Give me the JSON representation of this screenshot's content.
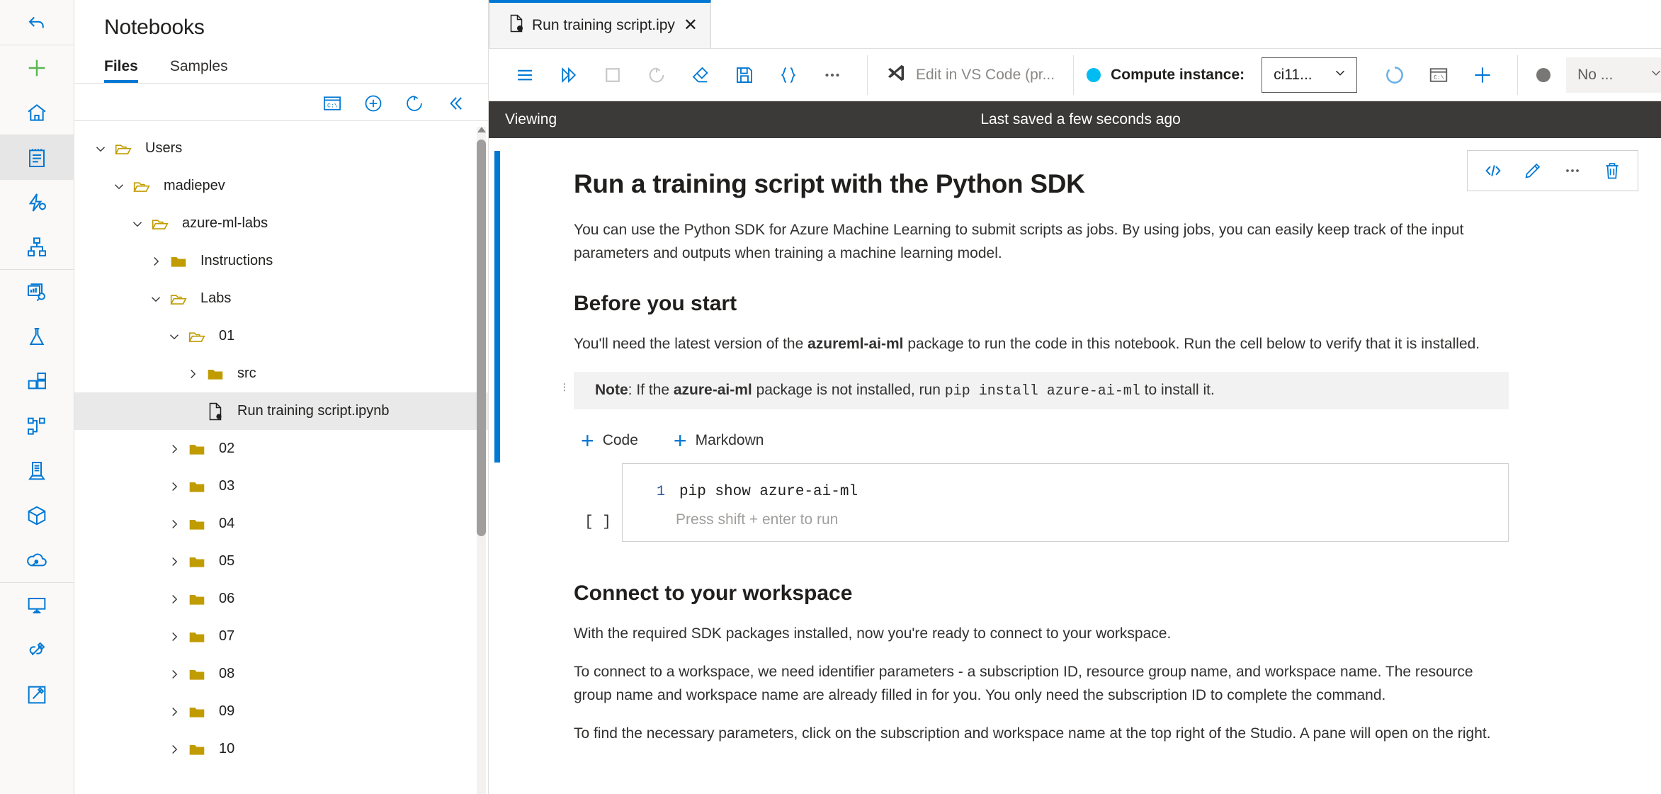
{
  "rail": {
    "items": [
      {
        "name": "back-arrow-icon",
        "label": "Back"
      },
      {
        "name": "create-new-icon",
        "label": "Create new"
      },
      {
        "name": "home-icon",
        "label": "Home"
      },
      {
        "name": "notebooks-icon",
        "label": "Notebooks"
      },
      {
        "name": "automated-ml-icon",
        "label": "Automated ML"
      },
      {
        "name": "designer-icon",
        "label": "Designer"
      },
      {
        "name": "data-icon",
        "label": "Data"
      },
      {
        "name": "jobs-icon",
        "label": "Jobs"
      },
      {
        "name": "components-icon",
        "label": "Components"
      },
      {
        "name": "pipelines-icon",
        "label": "Pipelines"
      },
      {
        "name": "environments-icon",
        "label": "Environments"
      },
      {
        "name": "models-icon",
        "label": "Models"
      },
      {
        "name": "endpoints-icon",
        "label": "Endpoints"
      },
      {
        "name": "compute-icon",
        "label": "Compute"
      },
      {
        "name": "linked-services-icon",
        "label": "Linked Services"
      },
      {
        "name": "data-labeling-icon",
        "label": "Data labeling"
      }
    ]
  },
  "files_panel": {
    "title": "Notebooks",
    "tabs": [
      {
        "label": "Files",
        "selected": true
      },
      {
        "label": "Samples",
        "selected": false
      }
    ],
    "toolbar": [
      {
        "name": "terminal-icon",
        "label": "Open terminal"
      },
      {
        "name": "add-files-icon",
        "label": "Create new file"
      },
      {
        "name": "refresh-icon",
        "label": "Refresh"
      },
      {
        "name": "collapse-icon",
        "label": "Collapse"
      }
    ],
    "tree": [
      {
        "label": "Users",
        "depth": 0,
        "type": "folder-open",
        "expanded": true,
        "selected": false
      },
      {
        "label": "madiepev",
        "depth": 1,
        "type": "folder-open",
        "expanded": true,
        "selected": false
      },
      {
        "label": "azure-ml-labs",
        "depth": 2,
        "type": "folder-open",
        "expanded": true,
        "selected": false
      },
      {
        "label": "Instructions",
        "depth": 3,
        "type": "folder-closed",
        "expanded": false,
        "selected": false
      },
      {
        "label": "Labs",
        "depth": 3,
        "type": "folder-open",
        "expanded": true,
        "selected": false
      },
      {
        "label": "01",
        "depth": 4,
        "type": "folder-open",
        "expanded": true,
        "selected": false
      },
      {
        "label": "src",
        "depth": 5,
        "type": "folder-closed",
        "expanded": false,
        "selected": false
      },
      {
        "label": "Run training script.ipynb",
        "depth": 5,
        "type": "notebook",
        "expanded": null,
        "selected": true
      },
      {
        "label": "02",
        "depth": 4,
        "type": "folder-closed",
        "expanded": false,
        "selected": false
      },
      {
        "label": "03",
        "depth": 4,
        "type": "folder-closed",
        "expanded": false,
        "selected": false
      },
      {
        "label": "04",
        "depth": 4,
        "type": "folder-closed",
        "expanded": false,
        "selected": false
      },
      {
        "label": "05",
        "depth": 4,
        "type": "folder-closed",
        "expanded": false,
        "selected": false
      },
      {
        "label": "06",
        "depth": 4,
        "type": "folder-closed",
        "expanded": false,
        "selected": false
      },
      {
        "label": "07",
        "depth": 4,
        "type": "folder-closed",
        "expanded": false,
        "selected": false
      },
      {
        "label": "08",
        "depth": 4,
        "type": "folder-closed",
        "expanded": false,
        "selected": false
      },
      {
        "label": "09",
        "depth": 4,
        "type": "folder-closed",
        "expanded": false,
        "selected": false
      },
      {
        "label": "10",
        "depth": 4,
        "type": "folder-closed",
        "expanded": false,
        "selected": false
      }
    ]
  },
  "notebook_tab": {
    "label": "Run training script.ipy",
    "close_label": "✕"
  },
  "toolbar": {
    "buttons": [
      {
        "name": "menu-icon",
        "label": "Menu"
      },
      {
        "name": "run-all-icon",
        "label": "Run all"
      },
      {
        "name": "stop-icon",
        "label": "Stop"
      },
      {
        "name": "restart-icon",
        "label": "Restart kernel"
      },
      {
        "name": "clear-outputs-icon",
        "label": "Clear outputs"
      },
      {
        "name": "save-icon",
        "label": "Save"
      },
      {
        "name": "json-icon",
        "label": "Edit JSON"
      },
      {
        "name": "more-icon",
        "label": "More"
      }
    ],
    "vscode_label": "Edit in VS Code (pr...",
    "compute_label": "Compute instance:",
    "compute_value": "ci11...",
    "compute_status_color": "#00bcf2",
    "kernel_value": "No ...",
    "kernel_status_color": "#797775",
    "compute_actions": [
      {
        "name": "compute-spinner-icon",
        "label": "Loading"
      },
      {
        "name": "terminal-icon",
        "label": "Terminal"
      },
      {
        "name": "add-compute-icon",
        "label": "New compute"
      }
    ]
  },
  "status_bar": {
    "mode": "Viewing",
    "saved": "Last saved a few seconds ago"
  },
  "cell_tools": [
    {
      "name": "convert-to-code-icon",
      "label": "</>"
    },
    {
      "name": "edit-pencil-icon",
      "label": "Edit"
    },
    {
      "name": "more-options-icon",
      "label": "•••"
    },
    {
      "name": "delete-trash-icon",
      "label": "Delete"
    }
  ],
  "content": {
    "h1": "Run a training script with the Python SDK",
    "p1": "You can use the Python SDK for Azure Machine Learning to submit scripts as jobs. By using jobs, you can easily keep track of the input parameters and outputs when training a machine learning model.",
    "h2_before": "Before you start",
    "p2_pre": "You'll need the latest version of the ",
    "p2_bold": "azureml-ai-ml",
    "p2_post": " package to run the code in this notebook. Run the cell below to verify that it is installed.",
    "note_label": "Note",
    "note_pre": ": If the ",
    "note_bold": "azure-ai-ml",
    "note_mid": " package is not installed, run ",
    "note_code": "pip install azure-ai-ml",
    "note_post": " to install it.",
    "add_code_label": "Code",
    "add_markdown_label": "Markdown",
    "cell_exec_count": "[ ]",
    "cell_line_number": "1",
    "cell_code": "pip show azure-ai-ml",
    "cell_hint": "Press shift + enter to run",
    "h2_connect": "Connect to your workspace",
    "p3": "With the required SDK packages installed, now you're ready to connect to your workspace.",
    "p4": "To connect to a workspace, we need identifier parameters - a subscription ID, resource group name, and workspace name. The resource group name and workspace name are already filled in for you. You only need the subscription ID to complete the command.",
    "p5": "To find the necessary parameters, click on the subscription and workspace name at the top right of the Studio. A pane will open on the right."
  },
  "colors": {
    "accent": "#0078d4",
    "folder": "#c19c00",
    "status_bar_bg": "#3b3a39",
    "selection": "#e9e9e9"
  }
}
